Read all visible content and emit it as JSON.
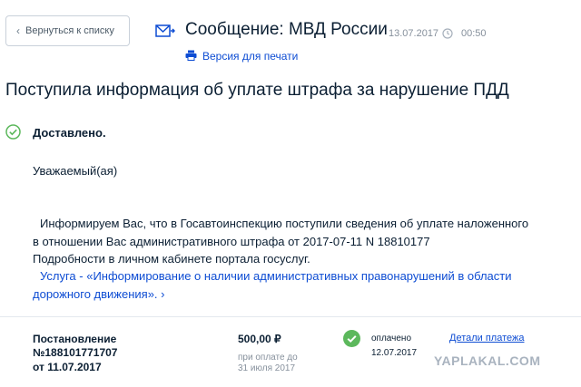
{
  "nav": {
    "back_label": "Вернуться к списку"
  },
  "header": {
    "title": "Сообщение: МВД России",
    "date": "13.07.2017",
    "time": "00:50",
    "print_label": "Версия для печати"
  },
  "message": {
    "subject": "Поступила информация об уплате штрафа за нарушение ПДД",
    "status": "Доставлено.",
    "greeting": "Уважаемый(ая)",
    "body_line1": "Информируем Вас, что в Госавтоинспекцию поступили сведения об уплате наложенного",
    "body_line2": "в отношении Вас административного штрафа от 2017-07-11 N 18810177",
    "body_line3": "Подробности в личном кабинете портала госуслуг.",
    "service_line1": "Услуга - «Информирование о наличии административных правонарушений в области",
    "service_line2": "дорожного движения». ›"
  },
  "payment": {
    "ruling_line1": "Постановление",
    "ruling_line2": "№188101771707",
    "ruling_line3": "от 11.07.2017",
    "amount": "500,00 ₽",
    "due_line1": "при оплате до",
    "due_line2": "31 июля 2017",
    "paid_status": "оплачено",
    "paid_date": "12.07.2017",
    "details_link": "Детали платежа"
  },
  "watermark": "YAPLAKAL.COM",
  "colors": {
    "accent": "#0d4cd3",
    "success": "#5cb85c",
    "muted": "#86909c"
  }
}
